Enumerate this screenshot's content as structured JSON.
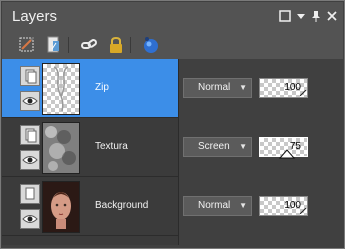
{
  "panel": {
    "title": "Layers",
    "window_buttons": [
      "maximize-icon",
      "dropdown-icon",
      "pin-icon",
      "close-icon"
    ]
  },
  "toolbar": {
    "icons": [
      "edit-icon",
      "properties-icon",
      "link-icon",
      "lock-icon",
      "globe-icon"
    ]
  },
  "layers": [
    {
      "name": "Zip",
      "selected": true,
      "thumbnail": "checkerboard",
      "blend_mode": "Normal",
      "opacity": "100"
    },
    {
      "name": "Textura",
      "selected": false,
      "thumbnail": "texture",
      "blend_mode": "Screen",
      "opacity": "75"
    },
    {
      "name": "Background",
      "selected": false,
      "thumbnail": "portrait",
      "blend_mode": "Normal",
      "opacity": "100"
    }
  ],
  "colors": {
    "selection": "#3c8ee8",
    "panel_bg": "#404040",
    "titlebar_bg": "#535353"
  }
}
